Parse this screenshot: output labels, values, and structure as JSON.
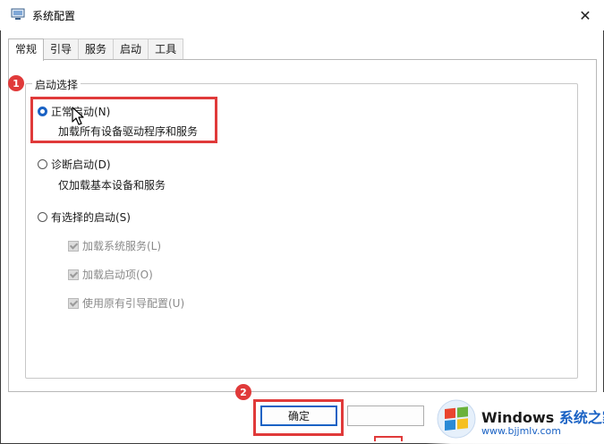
{
  "window": {
    "title": "系统配置",
    "close_glyph": "✕"
  },
  "tabs": [
    {
      "label": "常规",
      "active": true
    },
    {
      "label": "引导",
      "active": false
    },
    {
      "label": "服务",
      "active": false
    },
    {
      "label": "启动",
      "active": false
    },
    {
      "label": "工具",
      "active": false
    }
  ],
  "startup_group": {
    "legend": "启动选择",
    "options": [
      {
        "label": "正常启动(N)",
        "mnemonic": "N",
        "description": "加载所有设备驱动程序和服务",
        "selected": true
      },
      {
        "label": "诊断启动(D)",
        "mnemonic": "D",
        "description": "仅加载基本设备和服务",
        "selected": false
      },
      {
        "label": "有选择的启动(S)",
        "mnemonic": "S",
        "selected": false
      }
    ],
    "selective_items": [
      {
        "label": "加载系统服务(L)",
        "checked": true,
        "enabled": false
      },
      {
        "label": "加载启动项(O)",
        "checked": true,
        "enabled": false
      },
      {
        "label": "使用原有引导配置(U)",
        "checked": true,
        "enabled": false
      }
    ]
  },
  "buttons": {
    "ok_label": "确定"
  },
  "annotations": {
    "badge_1": "1",
    "badge_2": "2",
    "color": "#e03a3a"
  },
  "watermark": {
    "brand": "Windows",
    "site_name": "系统之家",
    "url": "www.bjjmlv.com"
  },
  "colors": {
    "accent": "#1a62c4",
    "annotation_red": "#e03a3a"
  }
}
